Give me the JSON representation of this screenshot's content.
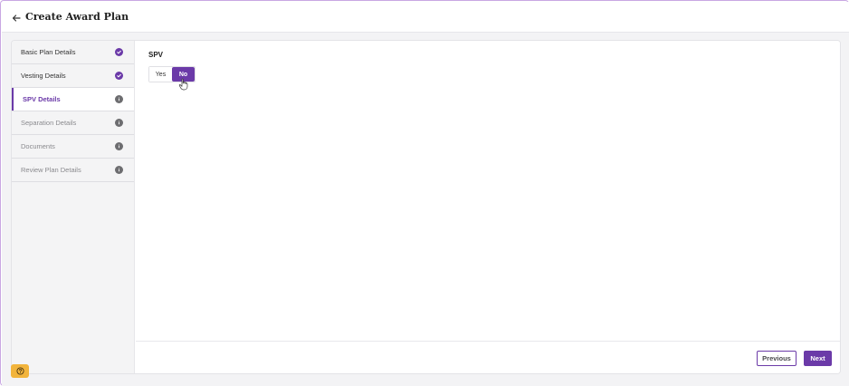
{
  "header": {
    "title": "Create Award Plan",
    "back_icon": "arrow-left-icon"
  },
  "sidebar": {
    "steps": [
      {
        "label": "Basic Plan Details",
        "status": "complete",
        "icon": "check-circle-icon"
      },
      {
        "label": "Vesting Details",
        "status": "complete",
        "icon": "check-circle-icon"
      },
      {
        "label": "SPV Details",
        "status": "active",
        "icon": "info-circle-icon"
      },
      {
        "label": "Separation Details",
        "status": "pending",
        "icon": "info-circle-icon"
      },
      {
        "label": "Documents",
        "status": "pending",
        "icon": "info-circle-icon"
      },
      {
        "label": "Review Plan Details",
        "status": "pending",
        "icon": "info-circle-icon"
      }
    ]
  },
  "form": {
    "spv_label": "SPV",
    "options": [
      {
        "label": "Yes",
        "selected": false
      },
      {
        "label": "No",
        "selected": true
      }
    ]
  },
  "footer": {
    "previous_label": "Previous",
    "next_label": "Next"
  },
  "help": {
    "icon": "help-circle-icon"
  },
  "colors": {
    "accent": "#6b3aa8",
    "help": "#f2b43c",
    "info_icon": "#6d6d70"
  }
}
